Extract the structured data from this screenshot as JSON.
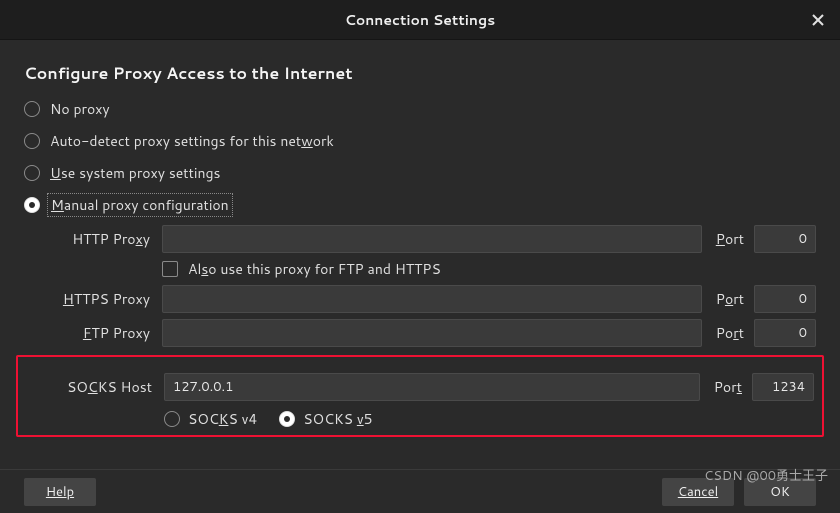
{
  "title": "Connection Settings",
  "sectionTitle": "Configure Proxy Access to the Internet",
  "radios": {
    "noProxy": "No proxy",
    "autoDetect_pre": "Auto-detect proxy settings for this net",
    "autoDetect_u": "w",
    "autoDetect_post": "ork",
    "system_u": "U",
    "system_post": "se system proxy settings",
    "manual_u": "M",
    "manual_post": "anual proxy configuration"
  },
  "selected": "manual",
  "http": {
    "label_pre": "HTTP Pro",
    "label_u": "x",
    "label_post": "y",
    "host": "",
    "port": "0",
    "port_lbl_u": "P",
    "port_lbl_post": "ort"
  },
  "also": {
    "pre": "Al",
    "u": "s",
    "post": "o use this proxy for FTP and HTTPS",
    "checked": false
  },
  "https": {
    "label_u": "H",
    "label_post": "TTPS Proxy",
    "host": "",
    "port": "0",
    "port_lbl_pre": "P",
    "port_lbl_u": "o",
    "port_lbl_post": "rt"
  },
  "ftp": {
    "label_u": "F",
    "label_post": "TP Proxy",
    "host": "",
    "port": "0",
    "port_lbl_pre": "Po",
    "port_lbl_u": "r",
    "port_lbl_post": "t"
  },
  "socks": {
    "label_pre": "SO",
    "label_u": "C",
    "label_post": "KS Host",
    "host": "127.0.0.1",
    "port": "1234",
    "port_lbl_pre": "Por",
    "port_lbl_u": "t"
  },
  "socksVersion": {
    "v4_pre": "SOC",
    "v4_u": "K",
    "v4_post": "S v4",
    "v5_pre": "SOCKS ",
    "v5_u": "v",
    "v5_post": "5",
    "selected": "v5"
  },
  "buttons": {
    "help": "Help",
    "cancel": "Cancel",
    "ok": "OK"
  },
  "watermark": "CSDN @00勇士王子"
}
